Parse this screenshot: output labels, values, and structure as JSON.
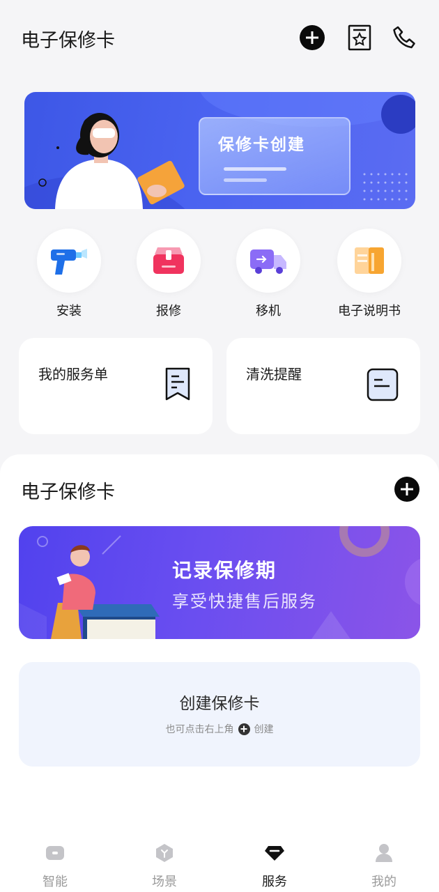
{
  "header": {
    "title": "电子保修卡"
  },
  "banner": {
    "card_title": "保修卡创建"
  },
  "quick_actions": [
    {
      "label": "安装",
      "icon": "drill-icon"
    },
    {
      "label": "报修",
      "icon": "toolbox-icon"
    },
    {
      "label": "移机",
      "icon": "truck-icon"
    },
    {
      "label": "电子说明书",
      "icon": "manual-book-icon"
    }
  ],
  "cards": [
    {
      "label": "我的服务单",
      "icon": "service-order-icon"
    },
    {
      "label": "清洗提醒",
      "icon": "clean-reminder-icon"
    }
  ],
  "section": {
    "title": "电子保修卡",
    "promo": {
      "title": "记录保修期",
      "subtitle": "享受快捷售后服务"
    },
    "create": {
      "title": "创建保修卡",
      "hint_prefix": "也可点击右上角",
      "hint_suffix": "创建"
    }
  },
  "tabbar": {
    "items": [
      {
        "label": "智能",
        "icon": "smart-device-icon"
      },
      {
        "label": "场景",
        "icon": "scene-icon"
      },
      {
        "label": "服务",
        "icon": "service-diamond-icon"
      },
      {
        "label": "我的",
        "icon": "profile-icon"
      }
    ],
    "active_index": 2
  },
  "colors": {
    "banner_blue": "#4a63f0",
    "promo_purple": "#6a4ef0",
    "create_bg": "#f0f4fd",
    "tab_active": "#1a1a1a",
    "tab_inactive": "#9a9a9a"
  }
}
